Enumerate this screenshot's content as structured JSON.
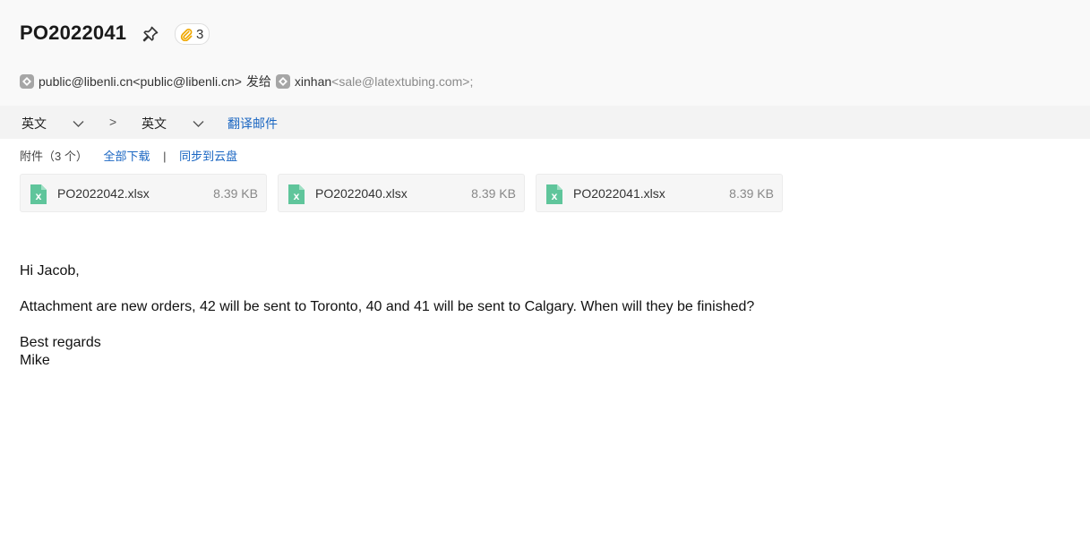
{
  "email": {
    "subject": "PO2022041",
    "attachment_badge_count": "3",
    "sender_name": "public@libenli.cn",
    "sender_email": "<public@libenli.cn>",
    "sent_to_label": "发给",
    "recipient_name": "xinhan",
    "recipient_email": "<sale@latextubing.com>;"
  },
  "translate_bar": {
    "source_lang": "英文",
    "arrow": ">",
    "target_lang": "英文",
    "translate_label": "翻译邮件"
  },
  "attachments": {
    "header_label": "附件（3 个）",
    "download_all": "全部下载",
    "separator": "|",
    "sync_cloud": "同步到云盘",
    "files": [
      {
        "name": "PO2022042.xlsx",
        "size": "8.39 KB"
      },
      {
        "name": "PO2022040.xlsx",
        "size": "8.39 KB"
      },
      {
        "name": "PO2022041.xlsx",
        "size": "8.39 KB"
      }
    ]
  },
  "body": {
    "greeting": "Hi Jacob,",
    "message": "Attachment are new orders, 42 will be sent to Toronto, 40 and 41 will be sent to Calgary. When will they be finished?",
    "closing": "Best regards",
    "signature": "Mike"
  },
  "colors": {
    "link": "#1a66c2",
    "excel_icon": "#5fc59b",
    "paperclip": "#f0a800"
  },
  "icons": [
    "pin-icon",
    "paperclip-icon",
    "avatar-icon",
    "chevron-down-icon",
    "excel-file-icon"
  ]
}
